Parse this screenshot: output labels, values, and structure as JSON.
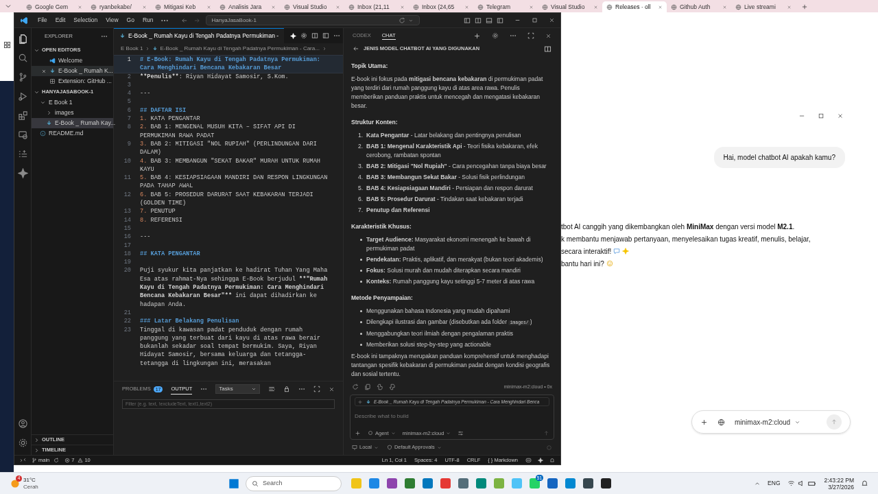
{
  "browser": {
    "tabs": [
      {
        "label": "Google Gem",
        "selected": false
      },
      {
        "label": "ryanbekabe/",
        "selected": false
      },
      {
        "label": "Mitigasi Keb",
        "selected": false
      },
      {
        "label": "Analisis Jara",
        "selected": false
      },
      {
        "label": "Visual Studio",
        "selected": false
      },
      {
        "label": "Inbox (21,11",
        "selected": false
      },
      {
        "label": "Inbox (24,65",
        "selected": false
      },
      {
        "label": "Telegram",
        "selected": false
      },
      {
        "label": "Visual Studio",
        "selected": false
      },
      {
        "label": "Releases · oll",
        "selected": true
      },
      {
        "label": "Github Auth",
        "selected": false
      },
      {
        "label": "Live streami",
        "selected": false
      }
    ],
    "page": {
      "user_message": "Hai, model chatbot AI apakah kamu?",
      "reply_lines": [
        {
          "text": "tbot AI canggih yang dikembangkan oleh **MiniMax** dengan versi model **M2.1**."
        },
        {
          "text": "k membantu menjawab pertanyaan, menyelesaikan tugas kreatif, menulis, belajar,"
        },
        {
          "text": "secara interaktif!",
          "kind": "chat"
        },
        {
          "text": "bantu hari ini?",
          "kind": "smile"
        }
      ],
      "model": "minimax-m2:cloud"
    }
  },
  "vscode": {
    "menus": [
      "File",
      "Edit",
      "Selection",
      "View",
      "Go",
      "Run"
    ],
    "command_center": "HanyaJasaBook-1",
    "activity_bar": [
      {
        "kind": "files",
        "selected": true
      },
      {
        "kind": "search",
        "selected": false
      },
      {
        "kind": "scm",
        "selected": false
      },
      {
        "kind": "run",
        "selected": false
      },
      {
        "kind": "extensions",
        "selected": false
      },
      {
        "kind": "remote",
        "selected": false
      },
      {
        "kind": "testing",
        "selected": false
      },
      {
        "kind": "sparkle",
        "selected": false
      }
    ],
    "explorer": {
      "title": "EXPLORER",
      "open_editors": {
        "title": "OPEN EDITORS",
        "items": [
          {
            "label": "Welcome",
            "kind": "vscode",
            "selected": false,
            "show_close": false
          },
          {
            "label": "E-Book _ Rumah K...",
            "kind": "markdown",
            "selected": true,
            "show_close": true
          },
          {
            "label": "Extension: GitHub ...",
            "kind": "extension",
            "selected": false,
            "show_close": false
          }
        ]
      },
      "workspace": {
        "title": "HANYAJASABOOK-1",
        "tree": [
          {
            "label": "E Book 1",
            "kind": "folder",
            "expanded": true,
            "selected": false,
            "children": [
              {
                "label": "images",
                "kind": "folder",
                "expanded": false,
                "selected": false
              },
              {
                "label": "E-Book _ Rumah Kay...",
                "kind": "markdown",
                "selected": true
              }
            ]
          },
          {
            "label": "README.md",
            "kind": "info",
            "selected": false
          }
        ]
      },
      "bottom_sections": [
        "OUTLINE",
        "TIMELINE"
      ]
    },
    "editor": {
      "tabs": [
        {
          "label": "E-Book _ Rumah Kayu di Tengah Padatnya Permukiman -",
          "selected": true
        }
      ],
      "breadcrumb": [
        "E Book 1",
        "E-Book _ Rumah Kayu di Tengah Padatnya Permukiman - Cara..."
      ],
      "lines": [
        {
          "number": "1",
          "current": true,
          "segments": [
            {
              "kind": "h1",
              "text": "# E-Book: Rumah Kayu di Tengah Padatnya Permukiman: Cara Menghindari Bencana Kebakaran Besar"
            }
          ]
        },
        {
          "number": "2",
          "current": false,
          "segments": [
            {
              "kind": "bold",
              "text": "**Penulis**"
            },
            {
              "kind": "plain",
              "text": ": Riyan Hidayat Samosir, S.Kom."
            }
          ]
        },
        {
          "number": "3",
          "current": false
        },
        {
          "number": "4",
          "current": false,
          "segments": [
            {
              "kind": "plain",
              "text": "---"
            }
          ]
        },
        {
          "number": "5",
          "current": false
        },
        {
          "number": "6",
          "current": false,
          "segments": [
            {
              "kind": "h2",
              "text": "## DAFTAR ISI"
            }
          ]
        },
        {
          "number": "7",
          "current": false,
          "segments": [
            {
              "kind": "num",
              "text": "1."
            },
            {
              "kind": "plain",
              "text": " KATA PENGANTAR"
            }
          ]
        },
        {
          "number": "8",
          "current": false,
          "segments": [
            {
              "kind": "num",
              "text": "2."
            },
            {
              "kind": "plain",
              "text": " BAB 1: MENGENAL MUSUH KITA – SIFAT API DI PERMUKIMAN RAWA PADAT"
            }
          ]
        },
        {
          "number": "9",
          "current": false,
          "segments": [
            {
              "kind": "num",
              "text": "3."
            },
            {
              "kind": "plain",
              "text": " BAB 2: MITIGASI \"NOL RUPIAH\" (PERLINDUNGAN DARI DALAM)"
            }
          ]
        },
        {
          "number": "10",
          "current": false,
          "segments": [
            {
              "kind": "num",
              "text": "4."
            },
            {
              "kind": "plain",
              "text": " BAB 3: MEMBANGUN \"SEKAT BAKAR\" MURAH UNTUK RUMAH KAYU"
            }
          ]
        },
        {
          "number": "11",
          "current": false,
          "segments": [
            {
              "kind": "num",
              "text": "5."
            },
            {
              "kind": "plain",
              "text": " BAB 4: KESIAPSIAGAAN MANDIRI DAN RESPON LINGKUNGAN PADA TAHAP AWAL"
            }
          ]
        },
        {
          "number": "12",
          "current": false,
          "segments": [
            {
              "kind": "num",
              "text": "6."
            },
            {
              "kind": "plain",
              "text": " BAB 5: PROSEDUR DARURAT SAAT KEBAKARAN TERJADI (GOLDEN TIME)"
            }
          ]
        },
        {
          "number": "13",
          "current": false,
          "segments": [
            {
              "kind": "num",
              "text": "7."
            },
            {
              "kind": "plain",
              "text": " PENUTUP"
            }
          ]
        },
        {
          "number": "14",
          "current": false,
          "segments": [
            {
              "kind": "num",
              "text": "8."
            },
            {
              "kind": "plain",
              "text": " REFERENSI"
            }
          ]
        },
        {
          "number": "15",
          "current": false
        },
        {
          "number": "16",
          "current": false,
          "segments": [
            {
              "kind": "plain",
              "text": "---"
            }
          ]
        },
        {
          "number": "17",
          "current": false
        },
        {
          "number": "18",
          "current": false,
          "segments": [
            {
              "kind": "h2",
              "text": "## KATA PENGANTAR"
            }
          ]
        },
        {
          "number": "19",
          "current": false
        },
        {
          "number": "20",
          "current": false,
          "segments": [
            {
              "kind": "plain",
              "text": "Puji syukur kita panjatkan ke hadirat Tuhan Yang Maha Esa atas rahmat-Nya sehingga E-Book berjudul "
            },
            {
              "kind": "bold",
              "text": "**\"Rumah Kayu di Tengah Padatnya Permukiman: Cara Menghindari Bencana Kebakaran Besar\"**"
            },
            {
              "kind": "plain",
              "text": " ini dapat dihadirkan ke hadapan Anda."
            }
          ]
        },
        {
          "number": "21",
          "current": false
        },
        {
          "number": "22",
          "current": false,
          "segments": [
            {
              "kind": "h2",
              "text": "### Latar Belakang Penulisan"
            }
          ]
        },
        {
          "number": "23",
          "current": false,
          "segments": [
            {
              "kind": "plain",
              "text": "Tinggal di kawasan padat penduduk dengan rumah panggung yang terbuat dari kayu di atas rawa berair bukanlah sekadar soal tempat bermukim. Saya, Riyan Hidayat Samosir, bersama keluarga dan tetangga-tetangga di lingkungan ini, merasakan"
            }
          ]
        }
      ]
    },
    "panel": {
      "tabs": [
        {
          "label": "PROBLEMS",
          "badge": "17",
          "selected": false
        },
        {
          "label": "OUTPUT",
          "selected": true
        }
      ],
      "select": "Tasks",
      "filter_placeholder": "Filter (e.g. text, !excludeText, text1,text2)"
    },
    "chat": {
      "tabs": [
        {
          "label": "CODEX",
          "selected": false
        },
        {
          "label": "CHAT",
          "selected": true
        }
      ],
      "title": "JENIS MODEL CHATBOT AI YANG DIGUNAKAN",
      "blocks": [
        {
          "kind": "heading",
          "text": "Topik Utama:"
        },
        {
          "kind": "paragraph",
          "text": "E-book ini fokus pada **mitigasi bencana kebakaran** di permukiman padat yang terdiri dari rumah panggung kayu di atas area rawa. Penulis memberikan panduan praktis untuk mencegah dan mengatasi kebakaran besar."
        },
        {
          "kind": "heading",
          "text": "Struktur Konten:"
        },
        {
          "kind": "ordered",
          "items": [
            {
              "marker": "1.",
              "parts": [
                {
                  "kind": "rich",
                  "text": "**Kata Pengantar** - Latar belakang dan pentingnya penulisan"
                }
              ]
            },
            {
              "marker": "2.",
              "parts": [
                {
                  "kind": "rich",
                  "text": "**BAB 1: Mengenal Karakteristik Api** - Teori fisika kebakaran, efek cerobong, rambatan spontan"
                }
              ]
            },
            {
              "marker": "3.",
              "parts": [
                {
                  "kind": "rich",
                  "text": "**BAB 2: Mitigasi \"Nol Rupiah\"** - Cara pencegahan tanpa biaya besar"
                }
              ]
            },
            {
              "marker": "4.",
              "parts": [
                {
                  "kind": "rich",
                  "text": "**BAB 3: Membangun Sekat Bakar** - Solusi fisik perlindungan"
                }
              ]
            },
            {
              "marker": "5.",
              "parts": [
                {
                  "kind": "rich",
                  "text": "**BAB 4: Kesiapsiagaan Mandiri** - Persiapan dan respon darurat"
                }
              ]
            },
            {
              "marker": "6.",
              "parts": [
                {
                  "kind": "rich",
                  "text": "**BAB 5: Prosedur Darurat** - Tindakan saat kebakaran terjadi"
                }
              ]
            },
            {
              "marker": "7.",
              "parts": [
                {
                  "kind": "rich",
                  "text": "**Penutup dan Referensi**"
                }
              ]
            }
          ]
        },
        {
          "kind": "heading",
          "text": "Karakteristik Khusus:"
        },
        {
          "kind": "bullets",
          "items": [
            {
              "parts": [
                {
                  "kind": "rich",
                  "text": "**Target Audience:** Masyarakat ekonomi menengah ke bawah di permukiman padat"
                }
              ]
            },
            {
              "parts": [
                {
                  "kind": "rich",
                  "text": "**Pendekatan:** Praktis, aplikatif, dan merakyat (bukan teori akademis)"
                }
              ]
            },
            {
              "parts": [
                {
                  "kind": "rich",
                  "text": "**Fokus:** Solusi murah dan mudah diterapkan secara mandiri"
                }
              ]
            },
            {
              "parts": [
                {
                  "kind": "rich",
                  "text": "**Konteks:** Rumah panggung kayu setinggi 5-7 meter di atas rawa"
                }
              ]
            }
          ]
        },
        {
          "kind": "heading",
          "text": "Metode Penyampaian:"
        },
        {
          "kind": "bullets",
          "items": [
            {
              "parts": [
                {
                  "kind": "rich",
                  "text": "Menggunakan bahasa Indonesia yang mudah dipahami"
                }
              ]
            },
            {
              "parts": [
                {
                  "kind": "rich",
                  "text": "Dilengkapi ilustrasi dan gambar (disebutkan ada folder "
                },
                {
                  "kind": "code",
                  "text": "images/"
                },
                {
                  "kind": "rich",
                  "text": ")"
                }
              ]
            },
            {
              "parts": [
                {
                  "kind": "rich",
                  "text": "Menggabungkan teori ilmiah dengan pengalaman praktis"
                }
              ]
            },
            {
              "parts": [
                {
                  "kind": "rich",
                  "text": "Memberikan solusi step-by-step yang actionable"
                }
              ]
            }
          ]
        },
        {
          "kind": "paragraph",
          "text": "E-book ini tampaknya merupakan panduan komprehensif untuk menghadapi tantangan spesifik kebakaran di permukiman padat dengan kondisi geografis dan sosial tertentu."
        }
      ],
      "response_meta": "minimax-m2:cloud • 0x",
      "input": {
        "context": "E-Book _ Rumah Kayu di Tengah Padatnya Permukiman - Cara Menghindari Benca",
        "placeholder": "Describe what to build",
        "mode": "Agent",
        "model": "minimax-m2:cloud"
      },
      "options": [
        "Local",
        "Default Approvals"
      ]
    },
    "status_bar": {
      "branch": "main",
      "errors": "7",
      "warnings": "10",
      "right": [
        "Ln 1, Col 1",
        "Spaces: 4",
        "UTF-8",
        "CRLF",
        "{ } Markdown"
      ]
    }
  },
  "taskbar": {
    "weather": {
      "badge": "4",
      "temperature": "31°C",
      "condition": "Cerah"
    },
    "search_placeholder": "Search",
    "apps": [
      {
        "color": "#f0c419"
      },
      {
        "color": "#1e88e5"
      },
      {
        "color": "#8e44ad"
      },
      {
        "color": "#2e7d32"
      },
      {
        "color": "#0277bd"
      },
      {
        "color": "#e53935"
      },
      {
        "color": "#546e7a"
      },
      {
        "color": "#00897b"
      },
      {
        "color": "#7cb342"
      },
      {
        "color": "#4fc3f7"
      },
      {
        "color": "#25d366",
        "badge": "51"
      },
      {
        "color": "#1565c0"
      },
      {
        "color": "#0288d1"
      },
      {
        "color": "#37474f"
      },
      {
        "color": "#212121"
      }
    ],
    "language": "ENG",
    "time": "2:43:22 PM",
    "date": "3/27/2026"
  }
}
